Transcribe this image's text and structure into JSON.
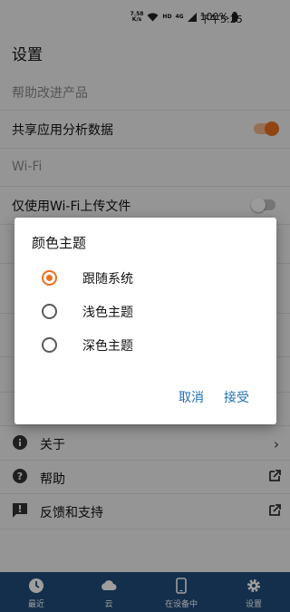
{
  "status_bar": {
    "net_speed_value": "7.58",
    "net_speed_unit": "K/s",
    "hd": "HD",
    "signal": "4G",
    "battery": "100%",
    "time": "下午5:25"
  },
  "header": {
    "title": "设置"
  },
  "sections": {
    "help_improve": "帮助改进产品",
    "share_analytics": "共享应用分析数据",
    "wifi": "Wi-Fi",
    "wifi_upload_only": "仅使用Wi-Fi上传文件"
  },
  "toggles": {
    "share_analytics_on": true,
    "wifi_upload_only_on": false
  },
  "list": {
    "about": "关于",
    "help": "帮助",
    "feedback": "反馈和支持"
  },
  "bottom_nav": {
    "items": [
      {
        "label": "最近",
        "icon": "clock-icon"
      },
      {
        "label": "云",
        "icon": "cloud-icon"
      },
      {
        "label": "在设备中",
        "icon": "phone-icon"
      },
      {
        "label": "设置",
        "icon": "gear-icon"
      }
    ]
  },
  "dialog": {
    "title": "颜色主题",
    "options": [
      "跟随系统",
      "浅色主题",
      "深色主题"
    ],
    "selected_index": 0,
    "cancel": "取消",
    "accept": "接受"
  },
  "colors": {
    "accent": "#e8701f",
    "nav_bg": "#1f4d7a",
    "button_text": "#1f6fb2"
  }
}
